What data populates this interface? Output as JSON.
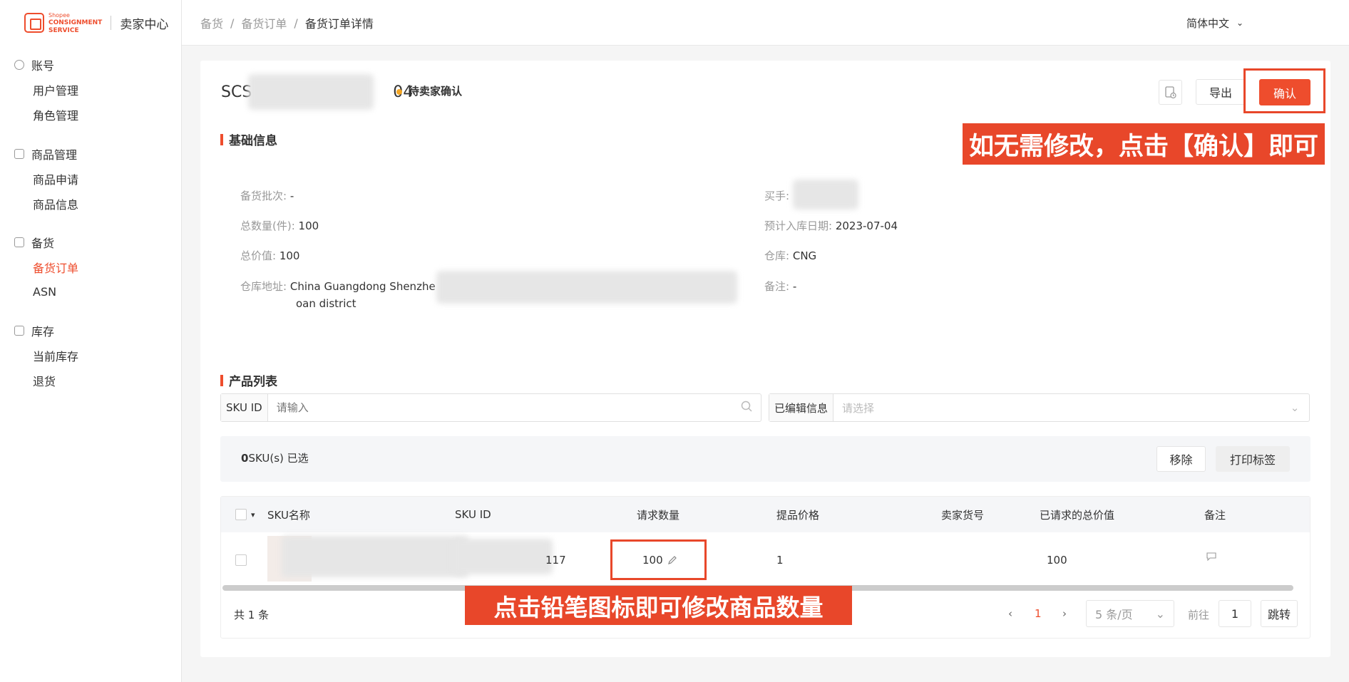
{
  "logo": {
    "small": "Shopee",
    "line1": "CONSIGNMENT",
    "line2": "SERVICE",
    "title": "卖家中心"
  },
  "sidebar": [
    {
      "label": "账号",
      "icon": "user-icon",
      "items": [
        {
          "label": "用户管理"
        },
        {
          "label": "角色管理"
        }
      ]
    },
    {
      "label": "商品管理",
      "icon": "box-icon",
      "items": [
        {
          "label": "商品申请"
        },
        {
          "label": "商品信息"
        }
      ]
    },
    {
      "label": "备货",
      "icon": "clipboard-icon",
      "items": [
        {
          "label": "备货订单",
          "active": true
        },
        {
          "label": "ASN"
        }
      ]
    },
    {
      "label": "库存",
      "icon": "home-icon",
      "items": [
        {
          "label": "当前库存"
        },
        {
          "label": "退货"
        }
      ]
    }
  ],
  "breadcrumb": [
    "备货",
    "备货订单",
    "备货订单详情"
  ],
  "language": "简体中文",
  "order": {
    "prefix": "SCS",
    "suffix": "04",
    "status": "待卖家确认",
    "status_color": "#f5a623"
  },
  "actions": {
    "export": "导出",
    "confirm": "确认"
  },
  "basic_info": {
    "title": "基础信息",
    "fields": {
      "batch": {
        "label": "备货批次:",
        "value": "-"
      },
      "total_qty": {
        "label": "总数量(件):",
        "value": "100"
      },
      "total_value": {
        "label": "总价值:",
        "value": "100"
      },
      "address": {
        "label": "仓库地址:",
        "value1": "China Guangdong Shenzhe",
        "value2": "oan district"
      },
      "buyer": {
        "label": "买手:",
        "value": ""
      },
      "eta": {
        "label": "预计入库日期:",
        "value": "2023-07-04"
      },
      "warehouse": {
        "label": "仓库:",
        "value": "CNG"
      },
      "remark": {
        "label": "备注:",
        "value": "-"
      }
    }
  },
  "product_list": {
    "title": "产品列表",
    "search": {
      "label": "SKU ID",
      "placeholder": "请输入"
    },
    "filter": {
      "label": "已编辑信息",
      "placeholder": "请选择"
    },
    "selected_count": "0",
    "selected_text": "SKU(s) 已选",
    "remove": "移除",
    "print": "打印标签",
    "columns": [
      "SKU名称",
      "SKU ID",
      "请求数量",
      "提品价格",
      "卖家货号",
      "已请求的总价值",
      "备注"
    ],
    "rows": [
      {
        "sku_id_suffix": "117",
        "qty": "100",
        "price": "1",
        "seller_sku": "",
        "total": "100"
      }
    ],
    "total_text": "共 1 条"
  },
  "pagination": {
    "current": "1",
    "page_size": "5 条/页",
    "goto_label": "前往",
    "goto_value": "1",
    "jump": "跳转"
  },
  "annotations": {
    "confirm_hint": "如无需修改，点击【确认】即可",
    "pencil_hint": "点击铅笔图标即可修改商品数量",
    "color": "#e8472a"
  },
  "colors": {
    "brand": "#ee4d2d"
  }
}
